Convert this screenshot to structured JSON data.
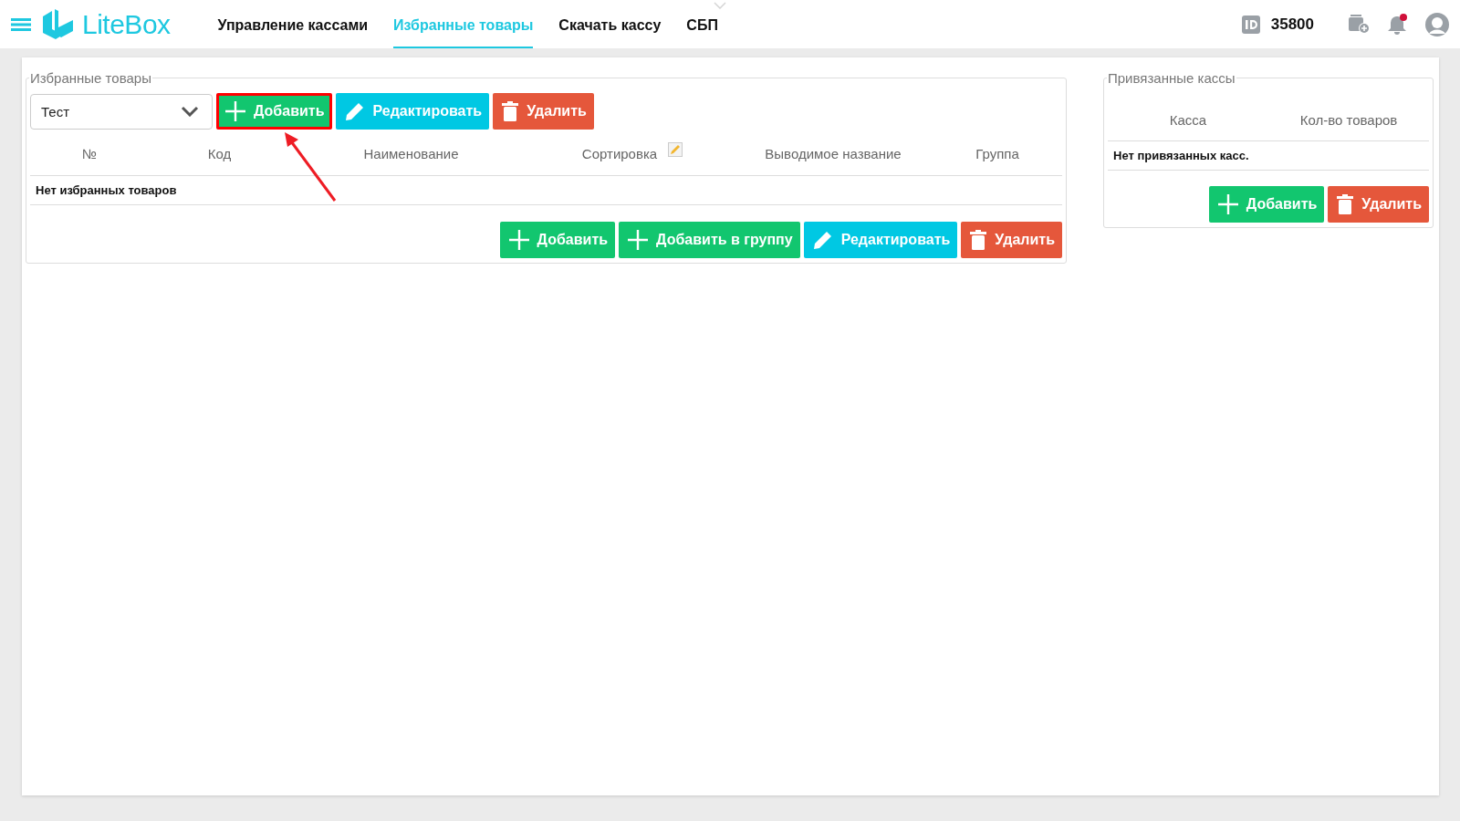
{
  "header": {
    "logo": "LiteBox",
    "nav": [
      {
        "label": "Управление кассами",
        "selected": false
      },
      {
        "label": "Избранные товары",
        "selected": true
      },
      {
        "label": "Скачать кассу",
        "selected": false
      },
      {
        "label": "СБП",
        "selected": false
      }
    ],
    "user_id": "35800",
    "notifications_unread": true
  },
  "favorites": {
    "title": "Избранные товары",
    "list_select": {
      "value": "Тест"
    },
    "top_buttons": [
      {
        "kind": "add",
        "label": "Добавить",
        "highlighted": true
      },
      {
        "kind": "edit",
        "label": "Редактировать",
        "highlighted": false
      },
      {
        "kind": "delete",
        "label": "Удалить",
        "highlighted": false
      }
    ],
    "columns": [
      {
        "label": "№",
        "editable": false
      },
      {
        "label": "Код",
        "editable": false
      },
      {
        "label": "Наименование",
        "editable": false
      },
      {
        "label": "Сортировка",
        "editable": true
      },
      {
        "label": "Выводимое название",
        "editable": false
      },
      {
        "label": "Группа",
        "editable": false
      }
    ],
    "empty_text": "Нет избранных товаров",
    "bottom_buttons": [
      {
        "kind": "add",
        "label": "Добавить",
        "highlighted": false
      },
      {
        "kind": "add",
        "label": "Добавить в группу",
        "highlighted": false
      },
      {
        "kind": "edit",
        "label": "Редактировать",
        "highlighted": false
      },
      {
        "kind": "delete",
        "label": "Удалить",
        "highlighted": false
      }
    ]
  },
  "linked": {
    "title": "Привязанные кассы",
    "columns": [
      {
        "label": "Касса",
        "editable": false
      },
      {
        "label": "Кол-во товаров",
        "editable": false
      }
    ],
    "empty_text": "Нет привязанных касс.",
    "buttons": [
      {
        "kind": "add",
        "label": "Добавить",
        "highlighted": false
      },
      {
        "kind": "delete",
        "label": "Удалить",
        "highlighted": false
      }
    ]
  }
}
